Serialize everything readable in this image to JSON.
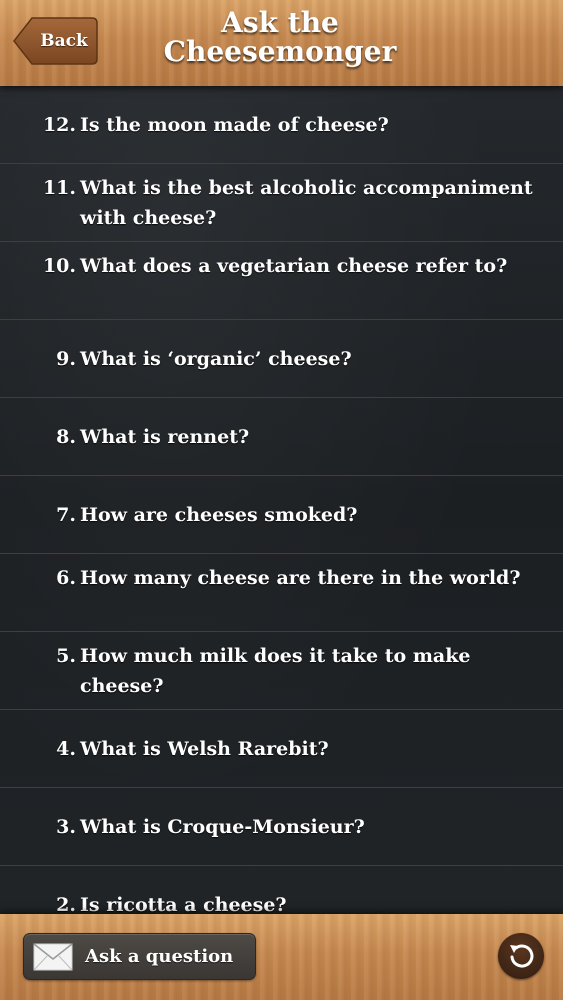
{
  "header": {
    "back_label": "Back",
    "title_line1": "Ask the",
    "title_line2": "Cheesemonger"
  },
  "questions": [
    {
      "num": "12.",
      "text": "Is the moon made of cheese?"
    },
    {
      "num": "11.",
      "text": "What is the best alcoholic accompaniment with cheese?"
    },
    {
      "num": "10.",
      "text": "What does a vegetarian cheese refer to?"
    },
    {
      "num": "9.",
      "text": "What is ‘organic’ cheese?"
    },
    {
      "num": "8.",
      "text": "What is rennet?"
    },
    {
      "num": "7.",
      "text": "How are cheeses smoked?"
    },
    {
      "num": "6.",
      "text": "How many cheese are there in the world?"
    },
    {
      "num": "5.",
      "text": "How much milk does it take to make cheese?"
    },
    {
      "num": "4.",
      "text": "What is Welsh Rarebit?"
    },
    {
      "num": "3.",
      "text": "What is Croque-Monsieur?"
    },
    {
      "num": "2.",
      "text": "Is ricotta a cheese?"
    }
  ],
  "footer": {
    "ask_label": "Ask a question",
    "ask_icon": "envelope-icon",
    "refresh_icon": "refresh-icon"
  },
  "colors": {
    "wood": "#c98d52",
    "list_background": "#1f2326",
    "text": "#ffffff"
  }
}
